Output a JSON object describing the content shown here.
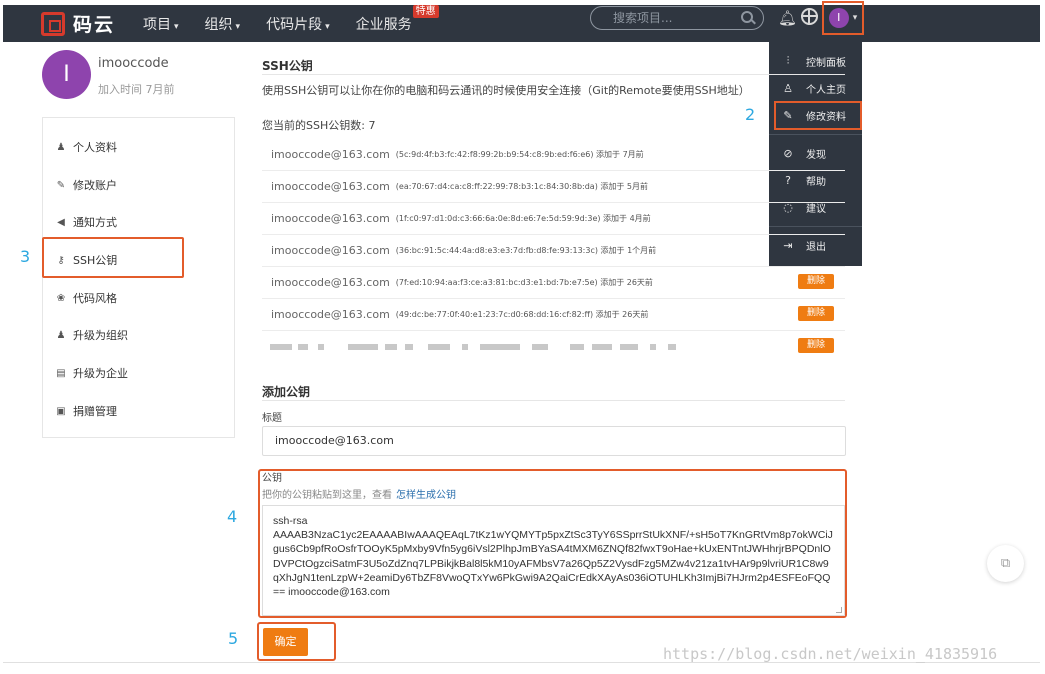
{
  "colors": {
    "topbar": "#2f3640",
    "accent": "#ef7c12",
    "highlight": "#e35c2b",
    "avatar": "#8e44ad",
    "step_number": "#2da8e0"
  },
  "header": {
    "logo_text": "码云",
    "nav": [
      {
        "label": "项目",
        "caret": "▾"
      },
      {
        "label": "组织",
        "caret": "▾"
      },
      {
        "label": "代码片段",
        "caret": "▾"
      },
      {
        "label": "企业服务",
        "caret": ""
      }
    ],
    "special_badge": "特惠",
    "search_placeholder": "搜索项目...",
    "avatar_letter": "I",
    "avatar_caret": "▾",
    "icons": [
      "logo-icon",
      "search-icon",
      "bell-icon",
      "globe-icon"
    ]
  },
  "dropdown": {
    "items": [
      {
        "label": "控制面板",
        "icon": "sliders-icon",
        "glyph": "⫶"
      },
      {
        "label": "个人主页",
        "icon": "user-icon",
        "glyph": "♙"
      },
      {
        "label": "修改资料",
        "icon": "edit-icon",
        "glyph": "✎"
      },
      {
        "label": "发现",
        "icon": "compass-icon",
        "glyph": "⊘"
      },
      {
        "label": "帮助",
        "icon": "help-icon",
        "glyph": "?"
      },
      {
        "label": "建议",
        "icon": "comment-icon",
        "glyph": "◌"
      },
      {
        "label": "退出",
        "icon": "logout-icon",
        "glyph": "⇥"
      }
    ]
  },
  "profile": {
    "avatar_letter": "I",
    "name": "imooccode",
    "joined": "加入时间 7月前"
  },
  "sidebar": {
    "items": [
      {
        "label": "个人资料",
        "icon": "user-icon",
        "glyph": "♟"
      },
      {
        "label": "修改账户",
        "icon": "pencil-icon",
        "glyph": "✎"
      },
      {
        "label": "通知方式",
        "icon": "volume-icon",
        "glyph": "◀"
      },
      {
        "label": "SSH公钥",
        "icon": "key-icon",
        "glyph": "⚷"
      },
      {
        "label": "代码风格",
        "icon": "code-style-icon",
        "glyph": "❀"
      },
      {
        "label": "升级为组织",
        "icon": "group-icon",
        "glyph": "♟"
      },
      {
        "label": "升级为企业",
        "icon": "building-icon",
        "glyph": "▤"
      },
      {
        "label": "捐赠管理",
        "icon": "gift-icon",
        "glyph": "▣"
      }
    ]
  },
  "steps": {
    "s2": "2",
    "s3": "3",
    "s4": "4",
    "s5": "5"
  },
  "ssh": {
    "title": "SSH公钥",
    "description": "使用SSH公钥可以让你在你的电脑和码云通讯的时候使用安全连接（Git的Remote要使用SSH地址）",
    "count_text": "您当前的SSH公钥数: 7",
    "delete_label": "删除",
    "keys": [
      {
        "email": "imooccode@163.com",
        "fingerprint": "(5c:9d:4f:b3:fc:42:f8:99:2b:b9:54:c8:9b:ed:f6:e6)",
        "added": "添加于 7月前"
      },
      {
        "email": "imooccode@163.com",
        "fingerprint": "(ea:70:67:d4:ca:c8:ff:22:99:78:b3:1c:84:30:8b:da)",
        "added": "添加于 5月前"
      },
      {
        "email": "imooccode@163.com",
        "fingerprint": "(1f:c0:97:d1:0d:c3:66:6a:0e:8d:e6:7e:5d:59:9d:3e)",
        "added": "添加于 4月前"
      },
      {
        "email": "imooccode@163.com",
        "fingerprint": "(36:bc:91:5c:44:4a:d8:e3:e3:7d:fb:d8:fe:93:13:3c)",
        "added": "添加于 1个月前"
      },
      {
        "email": "imooccode@163.com",
        "fingerprint": "(7f:ed:10:94:aa:f3:ce:a3:81:bc:d3:e1:bd:7b:e7:5e)",
        "added": "添加于 26天前"
      },
      {
        "email": "imooccode@163.com",
        "fingerprint": "(49:dc:be:77:0f:40:e1:23:7c:d0:68:dd:16:cf:82:ff)",
        "added": "添加于 26天前"
      }
    ]
  },
  "add": {
    "title": "添加公钥",
    "title_label": "标题",
    "title_value": "imooccode@163.com",
    "key_label": "公钥",
    "hint_text": "把你的公钥粘贴到这里，查看",
    "hint_link": "怎样生成公钥",
    "key_value": "ssh-rsa\nAAAAB3NzaC1yc2EAAAABIwAAAQEAqL7tKz1wYQMYTp5pxZtSc3TyY6SSprrStUkXNF/+sH5oT7KnGRtVm8p7okWCiJgus6Cb9pfRoOsfrTOOyK5pMxby9Vfn5yg6iVsl2PlhpJmBYaSA4tMXM6ZNQf82fwxT9oHae+kUxENTntJWHhrjrBPQDnlODVPCtOgzciSatmF3U5oZdZnq7LPBikjkBal8l5kM10yAFMbsV7a26Qp5Z2VysdFzg5MZw4v21za1tvHAr9p9lvriUR1C8w9qXhJgN1tenLzpW+2eamiDy6TbZF8VwoQTxYw6PkGwi9A2QaiCrEdkXAyAs036iOTUHLKh3ImjBi7HJrm2p4ESFEoFQQ== imooccode@163.com",
    "confirm_label": "确定"
  },
  "float_icon": "external-link-icon",
  "watermark": "https://blog.csdn.net/weixin_41835916"
}
